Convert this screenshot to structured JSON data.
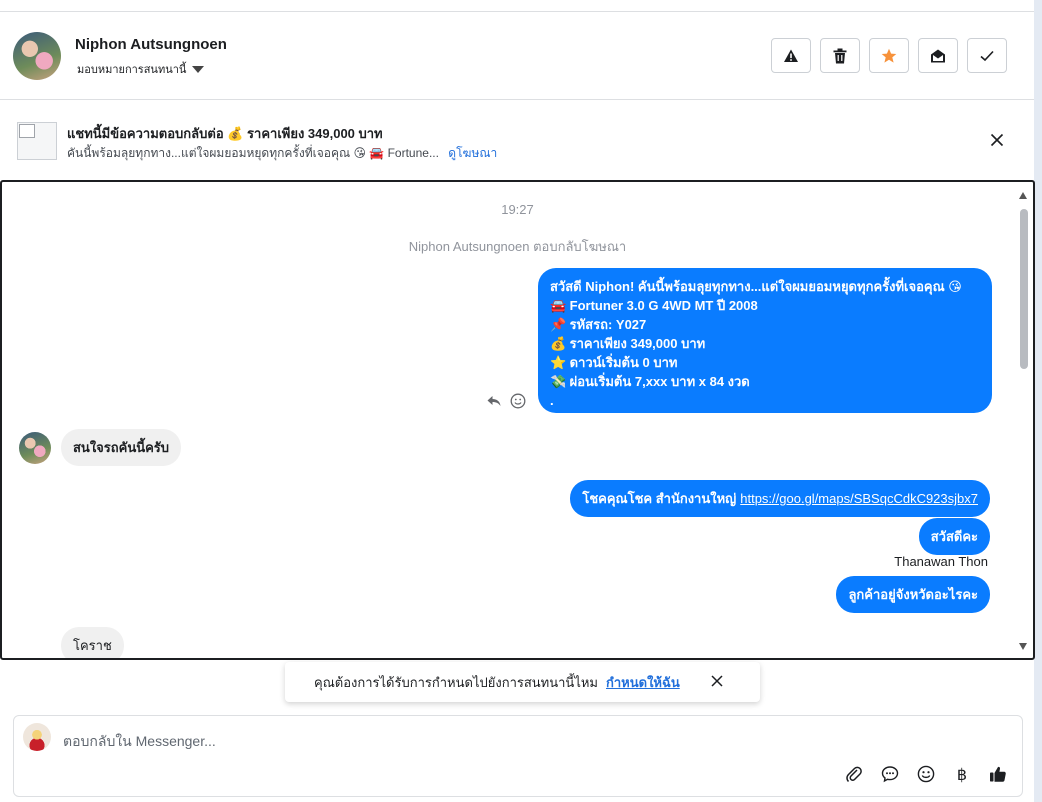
{
  "header": {
    "contact_name": "Niphon Autsungnoen",
    "assign_label": "มอบหมายการสนทนานี้",
    "actions": [
      {
        "name": "spam-button",
        "icon": "warning-icon"
      },
      {
        "name": "delete-button",
        "icon": "trash-icon"
      },
      {
        "name": "star-button",
        "icon": "star-icon"
      },
      {
        "name": "mark-unread-button",
        "icon": "envelope-open-icon"
      },
      {
        "name": "mark-done-button",
        "icon": "check-icon"
      }
    ],
    "star_color": "#f7923b"
  },
  "ad_banner": {
    "title": "แชทนี้มีข้อความตอบกลับต่อ 💰 ราคาเพียง 349,000 บาท",
    "subtitle": "คันนี้พร้อมลุยทุกทาง...แต่ใจผมยอมหยุดทุกครั้งที่เจอคุณ 😘 🚘 Fortune...",
    "link_label": "ดูโฆษณา"
  },
  "conversation": {
    "timestamp": "19:27",
    "system_note": "Niphon Autsungnoen ตอบกลับโฆษณา",
    "ad_reply_lines": [
      {
        "emoji": "",
        "text": "สวัสดี Niphon! คันนี้พร้อมลุยทุกทาง...แต่ใจผมยอมหยุดทุกครั้งที่เจอคุณ 😘"
      },
      {
        "emoji": "🚘",
        "text": "Fortuner 3.0 G 4WD MT ปี 2008"
      },
      {
        "emoji": "📌",
        "text": "รหัสรถ: Y027"
      },
      {
        "emoji": "💰",
        "text": "ราคาเพียง 349,000 บาท"
      },
      {
        "emoji": "⭐",
        "text": "ดาวน์เริ่มต้น 0 บาท"
      },
      {
        "emoji": "💸",
        "text": "ผ่อนเริ่มต้น 7,xxx บาท x 84 งวด"
      },
      {
        "emoji": "",
        "text": "."
      }
    ],
    "incoming_1": "สนใจรถคันนี้ครับ",
    "outgoing_1_text": "โชคคุณโชค สำนักงานใหญ่",
    "outgoing_1_link": "https://goo.gl/maps/SBSqcCdkC923sjbx7",
    "outgoing_2": "สวัสดีคะ",
    "sender_name": "Thanawan Thon",
    "outgoing_3": "ลูกค้าอยู่จังหวัดอะไรคะ",
    "incoming_2": "โคราช",
    "bubble_out_color": "#0a7cff",
    "bubble_in_color": "#f0f0f0"
  },
  "toast": {
    "text": "คุณต้องการได้รับการกำหนดไปยังการสนทนานี้ไหม",
    "link_label": "กำหนดให้ฉัน"
  },
  "composer": {
    "placeholder": "ตอบกลับใน Messenger...",
    "tools": [
      "paperclip-icon",
      "saved-replies-icon",
      "emoji-icon",
      "baht-icon",
      "thumbs-up-icon"
    ]
  }
}
